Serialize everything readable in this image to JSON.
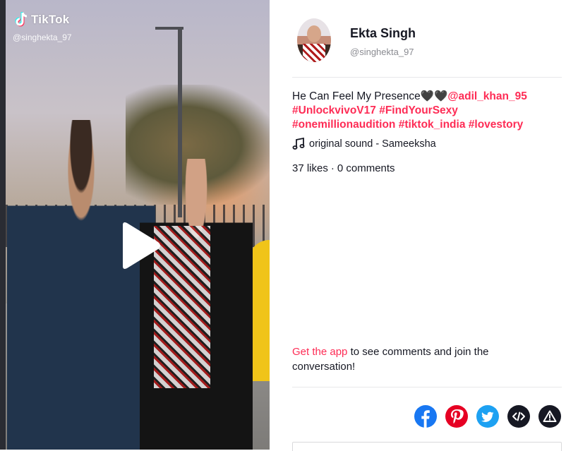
{
  "video": {
    "brand": "TikTok",
    "handle_watermark": "@singhekta_97",
    "play_icon": "play-icon"
  },
  "author": {
    "name": "Ekta Singh",
    "handle": "@singhekta_97"
  },
  "post": {
    "caption_text": "He Can Feel My Presence🖤🖤",
    "mention": "@adil_khan_95",
    "hashtags": [
      "#UnlockvivoV17",
      "#FindYourSexy",
      "#onemillionaudition",
      "#tiktok_india",
      "#lovestory"
    ],
    "sound_icon": "music-note-icon",
    "sound": "original sound - Sameeksha",
    "likes": "37 likes",
    "comments": "0 comments",
    "stats_separator": "·"
  },
  "cta": {
    "link": "Get the app",
    "text": " to see comments and join the conversation!"
  },
  "share_icons": [
    "facebook-icon",
    "pinterest-icon",
    "twitter-icon",
    "embed-code-icon",
    "report-icon"
  ],
  "colors": {
    "accent": "#fe2c55",
    "facebook": "#1877f2",
    "pinterest": "#e60023",
    "twitter": "#1da1f2",
    "dark": "#161823"
  }
}
